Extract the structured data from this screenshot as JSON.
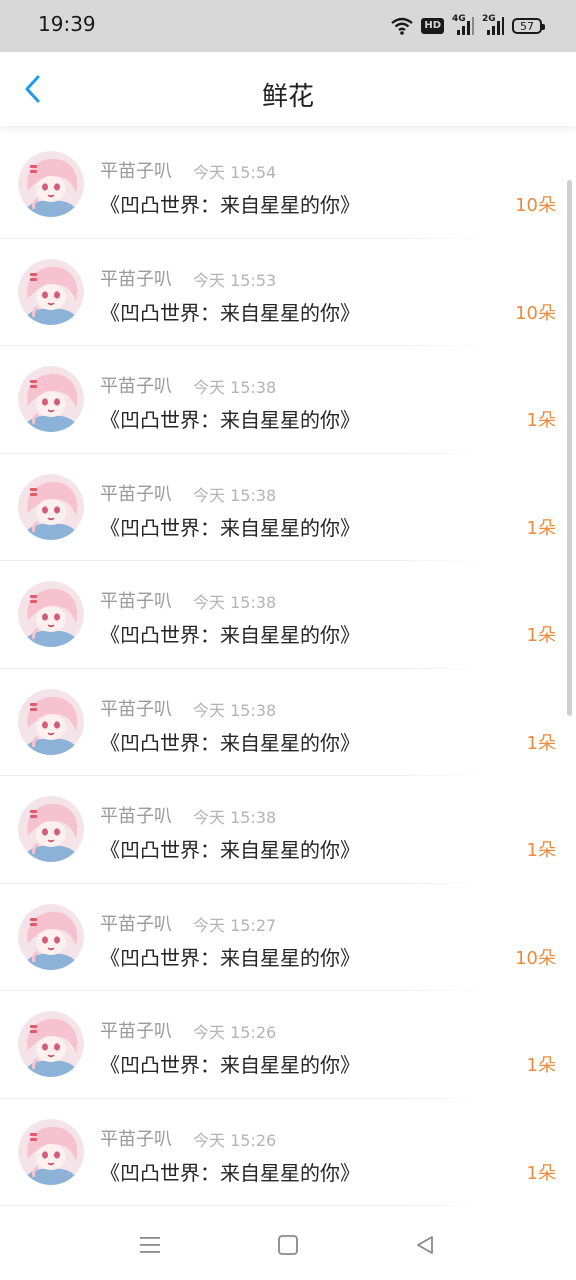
{
  "status_bar": {
    "time": "19:39",
    "hd_label": "HD",
    "network_1": "4G",
    "network_2": "2G",
    "battery": "57"
  },
  "header": {
    "title": "鲜花",
    "back_icon": "chevron-left-icon",
    "accent_color": "#1e9bf0"
  },
  "colors": {
    "amount": "#ee8a3c",
    "title_text": "#262626",
    "meta_text": "#9a9a9a"
  },
  "items": [
    {
      "sender": "平苗子叭",
      "time": "今天 15:54",
      "book": "《凹凸世界：来自星星的你》",
      "amount": "10朵"
    },
    {
      "sender": "平苗子叭",
      "time": "今天 15:53",
      "book": "《凹凸世界：来自星星的你》",
      "amount": "10朵"
    },
    {
      "sender": "平苗子叭",
      "time": "今天 15:38",
      "book": "《凹凸世界：来自星星的你》",
      "amount": "1朵"
    },
    {
      "sender": "平苗子叭",
      "time": "今天 15:38",
      "book": "《凹凸世界：来自星星的你》",
      "amount": "1朵"
    },
    {
      "sender": "平苗子叭",
      "time": "今天 15:38",
      "book": "《凹凸世界：来自星星的你》",
      "amount": "1朵"
    },
    {
      "sender": "平苗子叭",
      "time": "今天 15:38",
      "book": "《凹凸世界：来自星星的你》",
      "amount": "1朵"
    },
    {
      "sender": "平苗子叭",
      "time": "今天 15:38",
      "book": "《凹凸世界：来自星星的你》",
      "amount": "1朵"
    },
    {
      "sender": "平苗子叭",
      "time": "今天 15:27",
      "book": "《凹凸世界：来自星星的你》",
      "amount": "10朵"
    },
    {
      "sender": "平苗子叭",
      "time": "今天 15:26",
      "book": "《凹凸世界：来自星星的你》",
      "amount": "1朵"
    },
    {
      "sender": "平苗子叭",
      "time": "今天 15:26",
      "book": "《凹凸世界：来自星星的你》",
      "amount": "1朵"
    }
  ],
  "nav": {
    "menu_icon": "menu-icon",
    "home_icon": "square-home-icon",
    "back_icon": "triangle-back-icon"
  }
}
